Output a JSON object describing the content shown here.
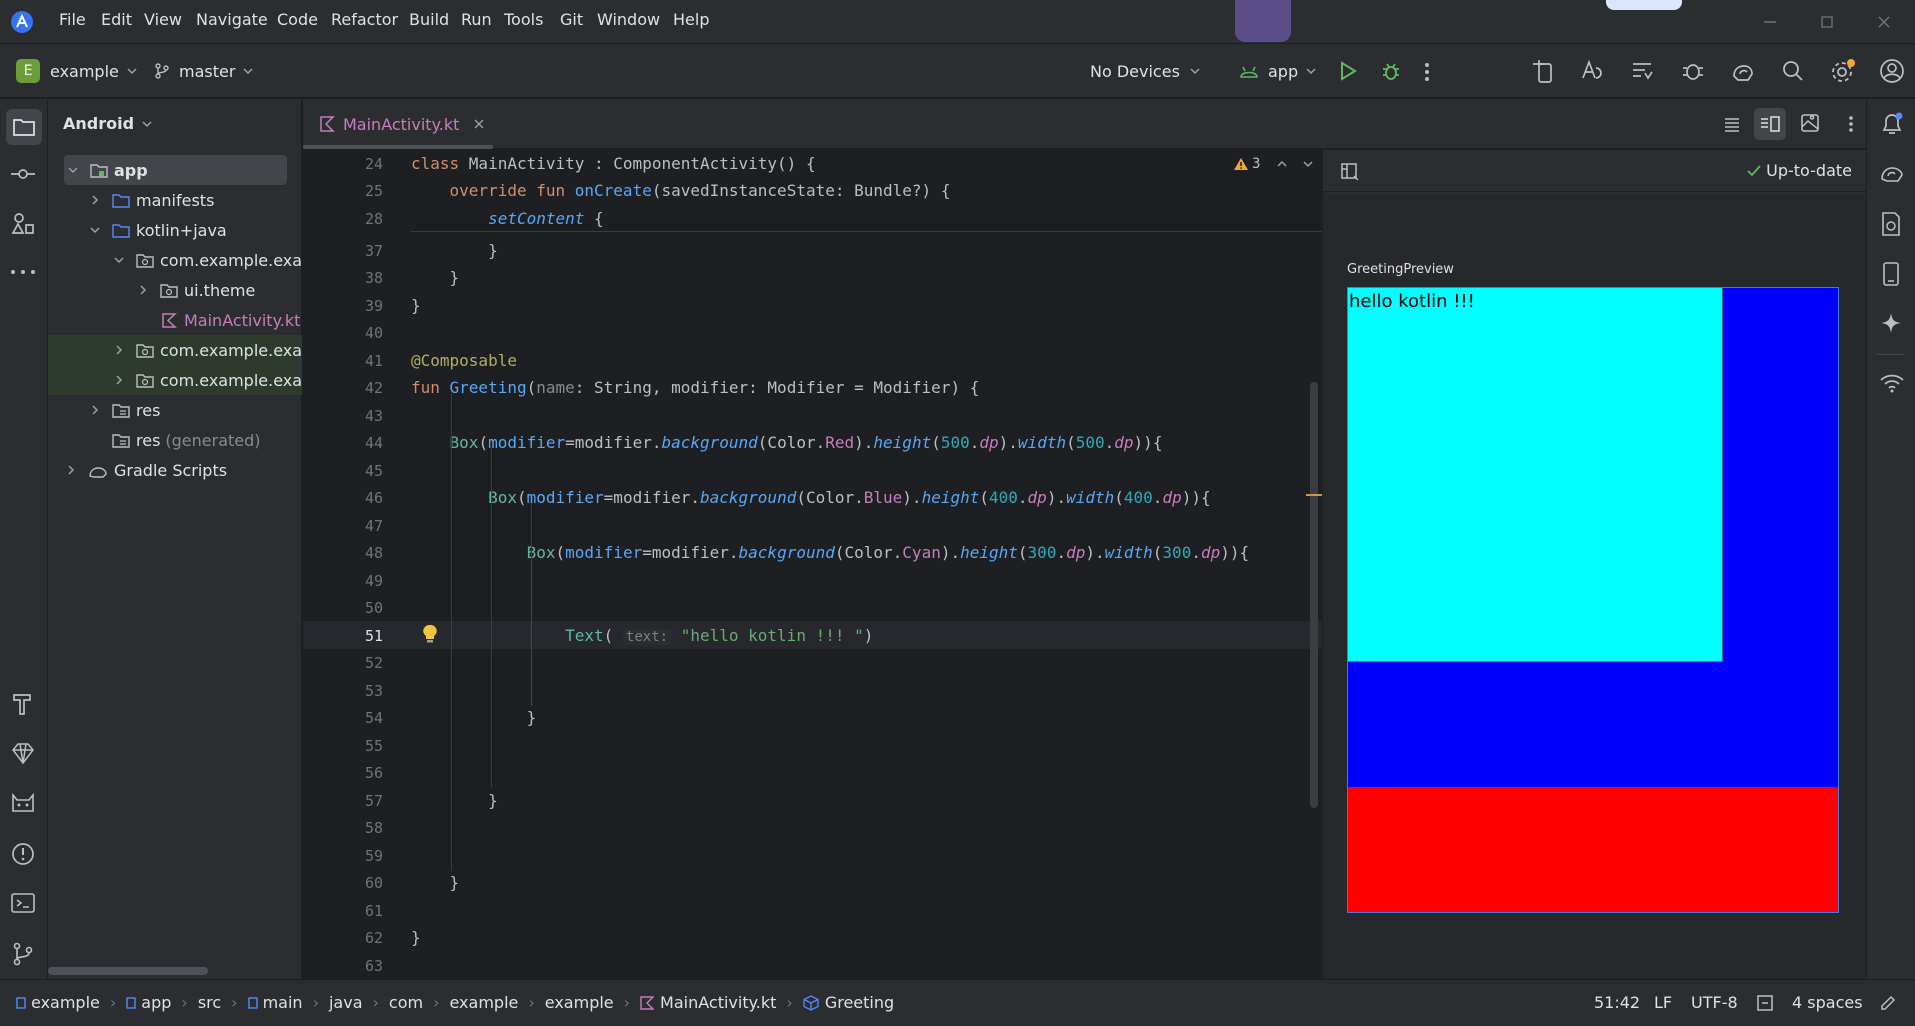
{
  "menu": [
    "File",
    "Edit",
    "View",
    "Navigate",
    "Code",
    "Refactor",
    "Build",
    "Run",
    "Tools",
    "Git",
    "Window",
    "Help"
  ],
  "toolbar": {
    "project_badge": "E",
    "project_name": "example",
    "branch": "master",
    "devices": "No Devices",
    "run_config": "app"
  },
  "project_panel": {
    "title": "Android",
    "items": [
      {
        "label": "app"
      },
      {
        "label": "manifests"
      },
      {
        "label": "kotlin+java"
      },
      {
        "label": "com.example.exam"
      },
      {
        "label": "ui.theme"
      },
      {
        "label": "MainActivity.kt"
      },
      {
        "label": "com.example.exam"
      },
      {
        "label": "com.example.exam"
      },
      {
        "label": "res"
      },
      {
        "label": "res",
        "suffix": "(generated)"
      },
      {
        "label": "Gradle Scripts"
      }
    ]
  },
  "editor": {
    "tab_label": "MainActivity.kt",
    "warning_count": "3",
    "line_numbers": [
      "24",
      "25",
      "28",
      "37",
      "38",
      "39",
      "40",
      "41",
      "42",
      "43",
      "44",
      "45",
      "46",
      "47",
      "48",
      "49",
      "50",
      "51",
      "52",
      "53",
      "54",
      "55",
      "56",
      "57",
      "58",
      "59",
      "60",
      "61",
      "62",
      "63"
    ]
  },
  "preview": {
    "status": "Up-to-date",
    "title": "GreetingPreview",
    "text": "hello kotlin !!!",
    "colors": {
      "red": "#ff0000",
      "blue": "#0000ff",
      "cyan": "#00ffff"
    }
  },
  "statusbar": {
    "crumbs": [
      "example",
      "app",
      "src",
      "main",
      "java",
      "com",
      "example",
      "example",
      "MainActivity.kt",
      "Greeting"
    ],
    "position": "51:42",
    "line_sep": "LF",
    "encoding": "UTF-8",
    "indent": "4 spaces"
  }
}
